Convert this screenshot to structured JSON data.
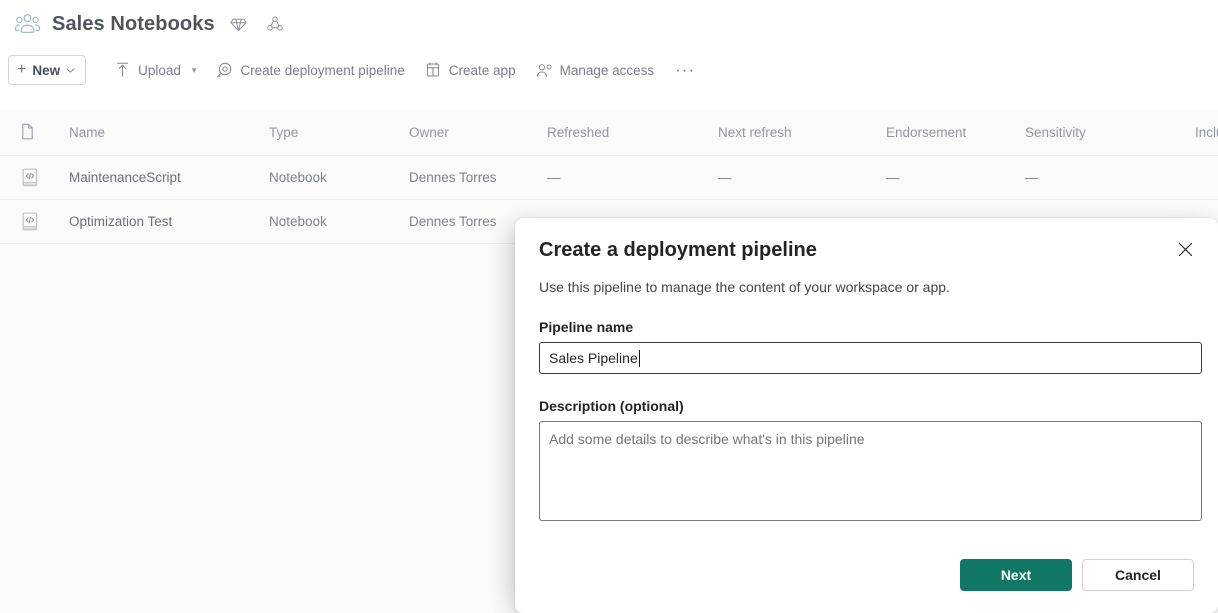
{
  "workspace": {
    "icon": "workspace-people-icon",
    "title": "Sales Notebooks",
    "badges": [
      {
        "icon": "diamond-premium-icon",
        "name": "premium-capacity-badge"
      },
      {
        "icon": "trio-shared-icon",
        "name": "shared-workspace-badge"
      }
    ]
  },
  "toolbar": {
    "new_label": "New",
    "items": [
      {
        "label": "Upload",
        "icon": "upload-arrow-icon",
        "has_caret": true
      },
      {
        "label": "Create deployment pipeline",
        "icon": "rocket-pipeline-icon",
        "has_caret": false
      },
      {
        "label": "Create app",
        "icon": "app-window-icon",
        "has_caret": false
      },
      {
        "label": "Manage access",
        "icon": "people-access-icon",
        "has_caret": false
      }
    ],
    "overflow_label": "···"
  },
  "table": {
    "columns": [
      "Name",
      "Type",
      "Owner",
      "Refreshed",
      "Next refresh",
      "Endorsement",
      "Sensitivity",
      "Inclu"
    ],
    "rows": [
      {
        "icon": "notebook-code-icon",
        "name": "MaintenanceScript",
        "type": "Notebook",
        "owner": "Dennes Torres",
        "refreshed": "—",
        "next_refresh": "—",
        "endorsement": "—",
        "sensitivity": "—",
        "included": ""
      },
      {
        "icon": "notebook-code-icon",
        "name": "Optimization Test",
        "type": "Notebook",
        "owner": "Dennes Torres",
        "refreshed": "",
        "next_refresh": "",
        "endorsement": "",
        "sensitivity": "",
        "included": ""
      }
    ]
  },
  "dialog": {
    "title": "Create a deployment pipeline",
    "subtitle": "Use this pipeline to manage the content of your workspace or app.",
    "name_label": "Pipeline name",
    "name_value": "Sales Pipeline",
    "description_label": "Description (optional)",
    "description_value": "",
    "description_placeholder": "Add some details to describe what's in this pipeline",
    "primary_button": "Next",
    "secondary_button": "Cancel",
    "close_icon": "close-x-icon"
  },
  "colors": {
    "accent": "#117865",
    "surface": "#ffffff",
    "table_bg": "#fafafa",
    "title_text": "#50555b",
    "muted_text": "#8a8e94",
    "workspace_icon": "#a8c4e0"
  }
}
